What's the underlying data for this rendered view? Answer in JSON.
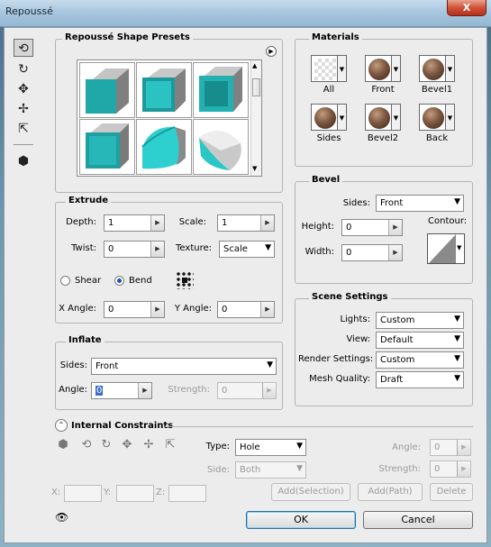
{
  "window": {
    "title": "Repoussé",
    "close_label": "X"
  },
  "presets": {
    "title": "Repoussé Shape Presets"
  },
  "materials": {
    "title": "Materials",
    "items": [
      {
        "label": "All",
        "kind": "checker"
      },
      {
        "label": "Front",
        "kind": "ball"
      },
      {
        "label": "Bevel1",
        "kind": "ball"
      },
      {
        "label": "Sides",
        "kind": "ball"
      },
      {
        "label": "Bevel2",
        "kind": "ball"
      },
      {
        "label": "Back",
        "kind": "ball"
      }
    ]
  },
  "extrude": {
    "title": "Extrude",
    "depth_label": "Depth:",
    "depth_value": "1",
    "scale_label": "Scale:",
    "scale_value": "1",
    "twist_label": "Twist:",
    "twist_value": "0",
    "texture_label": "Texture:",
    "texture_value": "Scale",
    "shear_label": "Shear",
    "bend_label": "Bend",
    "selected_mode": "Bend",
    "xangle_label": "X Angle:",
    "xangle_value": "0",
    "yangle_label": "Y Angle:",
    "yangle_value": "0"
  },
  "bevel": {
    "title": "Bevel",
    "sides_label": "Sides:",
    "sides_value": "Front",
    "height_label": "Height:",
    "height_value": "0",
    "width_label": "Width:",
    "width_value": "0",
    "contour_label": "Contour:"
  },
  "inflate": {
    "title": "Inflate",
    "sides_label": "Sides:",
    "sides_value": "Front",
    "angle_label": "Angle:",
    "angle_value": "0",
    "strength_label": "Strength:",
    "strength_value": "0"
  },
  "scene": {
    "title": "Scene Settings",
    "lights_label": "Lights:",
    "lights_value": "Custom",
    "view_label": "View:",
    "view_value": "Default",
    "render_label": "Render Settings:",
    "render_value": "Custom",
    "mesh_label": "Mesh Quality:",
    "mesh_value": "Draft"
  },
  "constraints": {
    "title": "Internal Constraints",
    "type_label": "Type:",
    "type_value": "Hole",
    "side_label": "Side:",
    "side_value": "Both",
    "angle_label": "Angle:",
    "angle_value": "0",
    "strength_label": "Strength:",
    "strength_value": "0",
    "x_label": "X:",
    "y_label": "Y:",
    "z_label": "Z:",
    "add_selection": "Add(Selection)",
    "add_path": "Add(Path)",
    "delete": "Delete"
  },
  "buttons": {
    "ok": "OK",
    "cancel": "Cancel"
  }
}
